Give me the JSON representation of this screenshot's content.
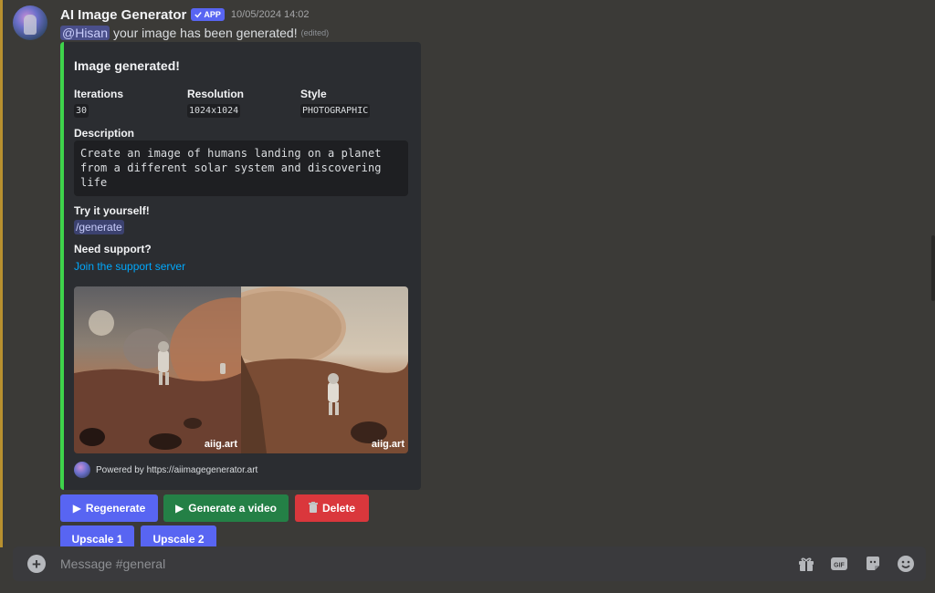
{
  "message": {
    "username": "AI Image Generator",
    "app_badge": "APP",
    "timestamp": "10/05/2024 14:02",
    "mention": "@Hisan",
    "text": "your image has been generated!",
    "edited": "(edited)"
  },
  "embed": {
    "accent_color": "#3ed34b",
    "title": "Image generated!",
    "fields": {
      "iterations_label": "Iterations",
      "iterations_value": "30",
      "resolution_label": "Resolution",
      "resolution_value": "1024x1024",
      "style_label": "Style",
      "style_value": "PHOTOGRAPHIC"
    },
    "description_label": "Description",
    "description_lines": [
      "Create an image of humans landing on a planet",
      "from a different solar system and discovering",
      "life"
    ],
    "try_label": "Try it yourself!",
    "command": "/generate",
    "support_label": "Need support?",
    "support_link": "Join the support server",
    "image_watermark": "aiig.art",
    "footer_text": "Powered by https://aiimagegenerator.art"
  },
  "buttons": {
    "regenerate": "Regenerate",
    "generate_video": "Generate a video",
    "delete": "Delete",
    "upscale_1": "Upscale 1",
    "upscale_2": "Upscale 2"
  },
  "composer": {
    "placeholder": "Message #general",
    "icons": [
      "plus-circle-icon",
      "gift-icon",
      "gif-icon",
      "sticker-icon",
      "emoji-icon"
    ]
  },
  "colors": {
    "blurple": "#5865f2",
    "green": "#248046",
    "red": "#da373c",
    "link": "#00a8fc"
  }
}
